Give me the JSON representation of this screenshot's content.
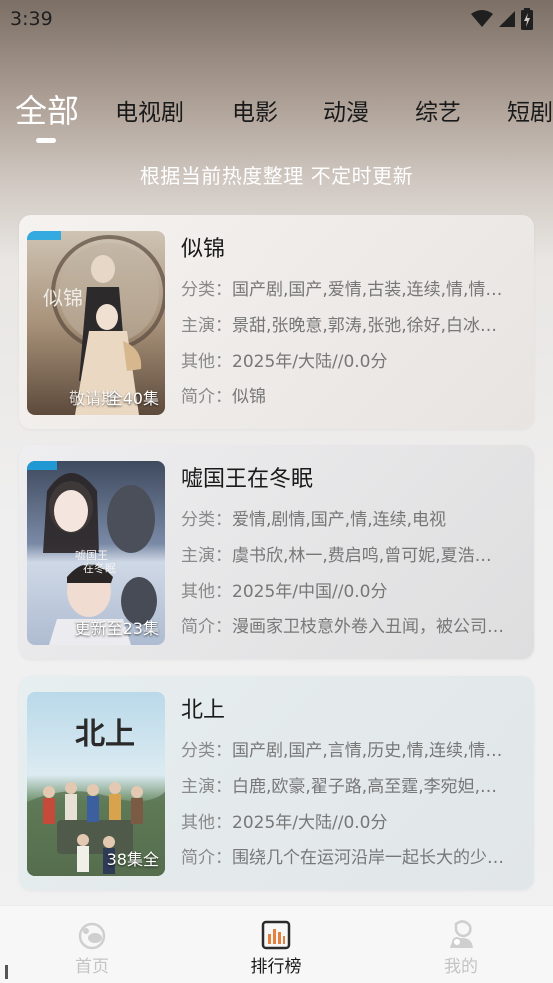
{
  "status_bar": {
    "time": "3:39"
  },
  "tabs": [
    "全部",
    "电视剧",
    "电影",
    "动漫",
    "综艺",
    "短剧"
  ],
  "active_tab": "全部",
  "subtitle": "根据当前热度整理 不定时更新",
  "labels": {
    "category": "分类：",
    "cast": "主演：",
    "other": "其他：",
    "intro": "简介："
  },
  "items": [
    {
      "title": "似锦",
      "category": "国产剧,国产,爱情,古装,连续,情,情…",
      "cast": "景甜,张晚意,郭涛,张弛,徐好,白冰…",
      "other": "2025年/大陆//0.0分",
      "intro": "似锦",
      "badge": "全40集",
      "poster_text": "敬请期"
    },
    {
      "title": "嘘国王在冬眠",
      "category": "爱情,剧情,国产,情,连续,电视",
      "cast": "虞书欣,林一,费启鸣,曾可妮,夏浩…",
      "other": "2025年/中国//0.0分",
      "intro": "漫画家卫枝意外卷入丑闻，被公司…",
      "badge": "更新至23集"
    },
    {
      "title": "北上",
      "category": "国产剧,国产,言情,历史,情,连续,情…",
      "cast": "白鹿,欧豪,翟子路,高至霆,李宛妲,…",
      "other": "2025年/大陆//0.0分",
      "intro": "围绕几个在运河沿岸一起长大的少…",
      "badge": "38集全",
      "poster_text": "北上"
    }
  ],
  "bottom_nav": [
    {
      "label": "首页",
      "icon": "home-icon"
    },
    {
      "label": "排行榜",
      "icon": "chart-icon"
    },
    {
      "label": "我的",
      "icon": "user-icon"
    }
  ],
  "colors": {
    "active_nav": "#1a1a1a",
    "inactive_nav": "#c4c4c4",
    "rank_icon": "#e5803f"
  }
}
